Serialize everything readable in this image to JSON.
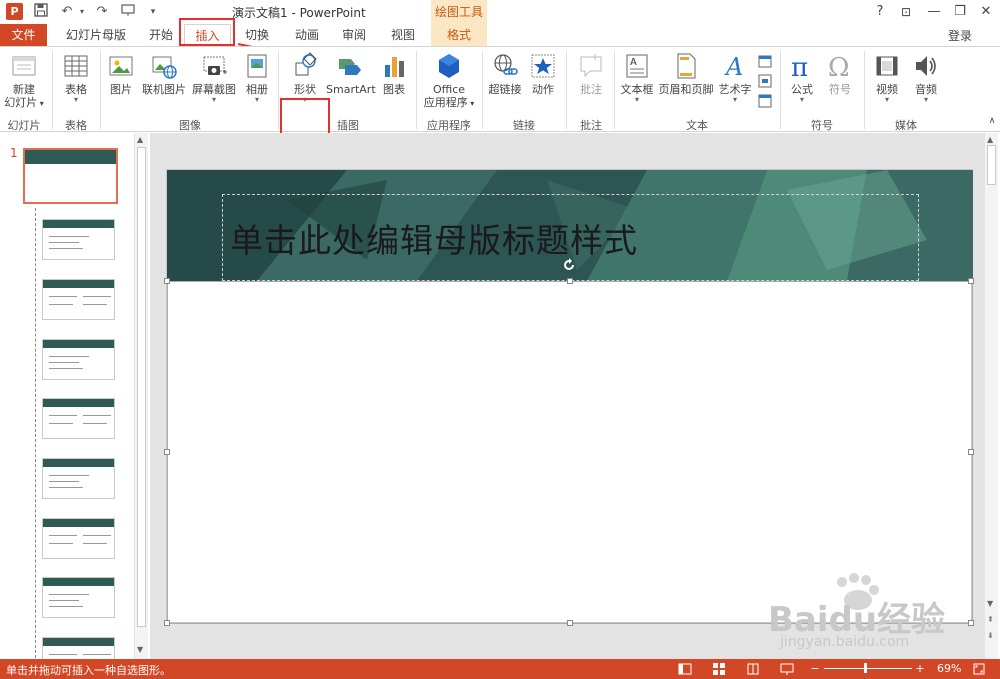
{
  "titlebar": {
    "doc_title": "演示文稿1 - PowerPoint",
    "app_letter": "P",
    "context_group": "绘图工具",
    "help": "?",
    "ribbon_opts": "⊡",
    "minimize": "—",
    "restore": "❐",
    "close": "✕"
  },
  "tabs": {
    "file": "文件",
    "slide_master": "幻灯片母版",
    "home": "开始",
    "insert": "插入",
    "transitions": "切换",
    "animations": "动画",
    "review": "审阅",
    "view": "视图",
    "format": "格式",
    "login": "登录"
  },
  "ribbon": {
    "new_slide": [
      "新建",
      "幻灯片"
    ],
    "table": "表格",
    "picture": "图片",
    "online_picture": "联机图片",
    "screenshot": "屏幕截图",
    "album": "相册",
    "shapes": "形状",
    "smartart": "SmartArt",
    "chart": "图表",
    "office_apps": [
      "Office",
      "应用程序"
    ],
    "hyperlink": "超链接",
    "action": "动作",
    "comment": "批注",
    "textbox": "文本框",
    "header_footer": "页眉和页脚",
    "wordart": "艺术字",
    "equation": "公式",
    "symbol": "符号",
    "video": "视频",
    "audio": "音频",
    "groups": {
      "slides": "幻灯片",
      "tables": "表格",
      "images": "图像",
      "illustrations": "插图",
      "apps": "应用程序",
      "links": "链接",
      "comments": "批注",
      "text": "文本",
      "symbols": "符号",
      "media": "媒体"
    }
  },
  "thumbnails": {
    "selected_number": "1",
    "count": 9
  },
  "slide": {
    "title_placeholder": "单击此处编辑母版标题样式"
  },
  "statusbar": {
    "text": "单击并拖动可插入一种自选图形。",
    "zoom_level": "69%",
    "zoom_fraction": 0.45
  },
  "colors": {
    "accent": "#d24726",
    "context_bg": "#fbe7c4",
    "highlight_box": "#e03030",
    "slide_header": "#2f5a55"
  },
  "watermark": {
    "brand": "Baidu经验",
    "url": "jingyan.baidu.com"
  }
}
